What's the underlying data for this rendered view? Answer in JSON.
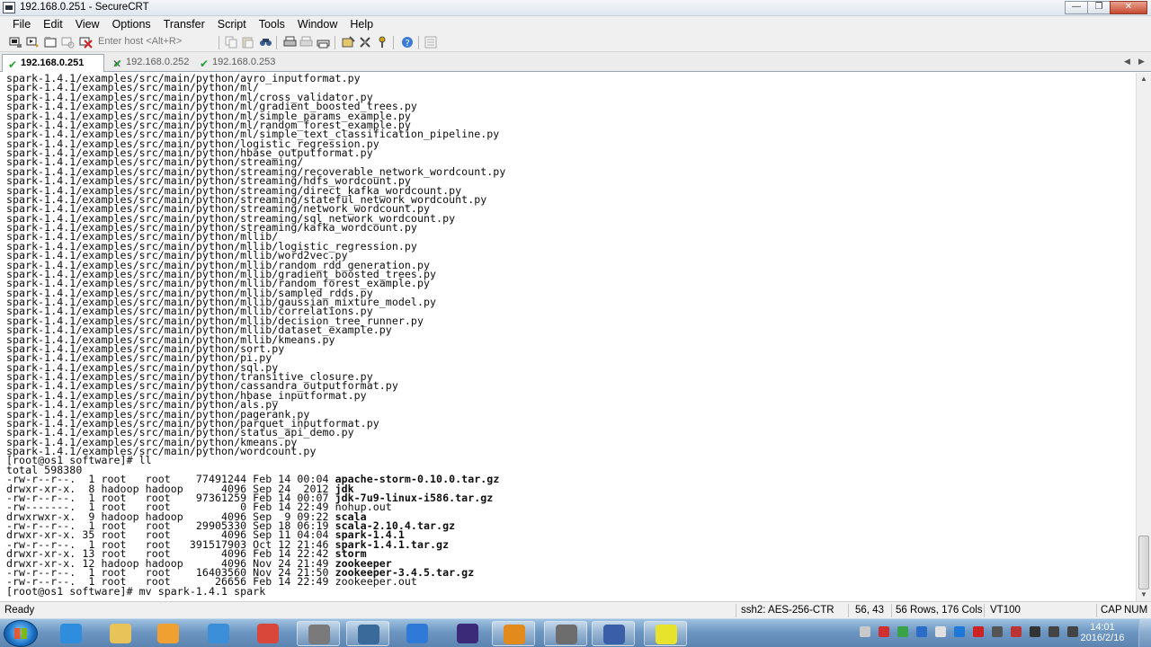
{
  "window": {
    "title": "192.168.0.251 - SecureCRT",
    "buttons": {
      "minimize": "—",
      "maximize": "❐",
      "close": "✕"
    }
  },
  "menu": [
    "File",
    "Edit",
    "View",
    "Options",
    "Transfer",
    "Script",
    "Tools",
    "Window",
    "Help"
  ],
  "toolbar": {
    "host_placeholder": "Enter host <Alt+R>",
    "icons": [
      "connect-icon",
      "quick-connect-icon",
      "connect-tab-icon",
      "reconnect-icon",
      "disconnect-icon",
      "copy-icon",
      "paste-icon",
      "find-icon",
      "print-icon",
      "print-selection-icon",
      "print-setup-icon",
      "session-options-icon",
      "global-options-icon",
      "keymap-icon",
      "help-icon",
      "sftp-icon"
    ]
  },
  "tabs": [
    {
      "label": "192.168.0.251",
      "active": true
    },
    {
      "label": "192.168.0.252",
      "active": false
    },
    {
      "label": "192.168.0.253",
      "active": false
    }
  ],
  "terminal": {
    "lines": [
      {
        "text": "spark-1.4.1/examples/src/main/python/avro_inputformat.py",
        "bold": false
      },
      {
        "text": "spark-1.4.1/examples/src/main/python/ml/",
        "bold": false
      },
      {
        "text": "spark-1.4.1/examples/src/main/python/ml/cross_validator.py",
        "bold": false
      },
      {
        "text": "spark-1.4.1/examples/src/main/python/ml/gradient_boosted_trees.py",
        "bold": false
      },
      {
        "text": "spark-1.4.1/examples/src/main/python/ml/simple_params_example.py",
        "bold": false
      },
      {
        "text": "spark-1.4.1/examples/src/main/python/ml/random_forest_example.py",
        "bold": false
      },
      {
        "text": "spark-1.4.1/examples/src/main/python/ml/simple_text_classification_pipeline.py",
        "bold": false
      },
      {
        "text": "spark-1.4.1/examples/src/main/python/logistic_regression.py",
        "bold": false
      },
      {
        "text": "spark-1.4.1/examples/src/main/python/hbase_outputformat.py",
        "bold": false
      },
      {
        "text": "spark-1.4.1/examples/src/main/python/streaming/",
        "bold": false
      },
      {
        "text": "spark-1.4.1/examples/src/main/python/streaming/recoverable_network_wordcount.py",
        "bold": false
      },
      {
        "text": "spark-1.4.1/examples/src/main/python/streaming/hdfs_wordcount.py",
        "bold": false
      },
      {
        "text": "spark-1.4.1/examples/src/main/python/streaming/direct_kafka_wordcount.py",
        "bold": false
      },
      {
        "text": "spark-1.4.1/examples/src/main/python/streaming/stateful_network_wordcount.py",
        "bold": false
      },
      {
        "text": "spark-1.4.1/examples/src/main/python/streaming/network_wordcount.py",
        "bold": false
      },
      {
        "text": "spark-1.4.1/examples/src/main/python/streaming/sql_network_wordcount.py",
        "bold": false
      },
      {
        "text": "spark-1.4.1/examples/src/main/python/streaming/kafka_wordcount.py",
        "bold": false
      },
      {
        "text": "spark-1.4.1/examples/src/main/python/mllib/",
        "bold": false
      },
      {
        "text": "spark-1.4.1/examples/src/main/python/mllib/logistic_regression.py",
        "bold": false
      },
      {
        "text": "spark-1.4.1/examples/src/main/python/mllib/word2vec.py",
        "bold": false
      },
      {
        "text": "spark-1.4.1/examples/src/main/python/mllib/random_rdd_generation.py",
        "bold": false
      },
      {
        "text": "spark-1.4.1/examples/src/main/python/mllib/gradient_boosted_trees.py",
        "bold": false
      },
      {
        "text": "spark-1.4.1/examples/src/main/python/mllib/random_forest_example.py",
        "bold": false
      },
      {
        "text": "spark-1.4.1/examples/src/main/python/mllib/sampled_rdds.py",
        "bold": false
      },
      {
        "text": "spark-1.4.1/examples/src/main/python/mllib/gaussian_mixture_model.py",
        "bold": false
      },
      {
        "text": "spark-1.4.1/examples/src/main/python/mllib/correlations.py",
        "bold": false
      },
      {
        "text": "spark-1.4.1/examples/src/main/python/mllib/decision_tree_runner.py",
        "bold": false
      },
      {
        "text": "spark-1.4.1/examples/src/main/python/mllib/dataset_example.py",
        "bold": false
      },
      {
        "text": "spark-1.4.1/examples/src/main/python/mllib/kmeans.py",
        "bold": false
      },
      {
        "text": "spark-1.4.1/examples/src/main/python/sort.py",
        "bold": false
      },
      {
        "text": "spark-1.4.1/examples/src/main/python/pi.py",
        "bold": false
      },
      {
        "text": "spark-1.4.1/examples/src/main/python/sql.py",
        "bold": false
      },
      {
        "text": "spark-1.4.1/examples/src/main/python/transitive_closure.py",
        "bold": false
      },
      {
        "text": "spark-1.4.1/examples/src/main/python/cassandra_outputformat.py",
        "bold": false
      },
      {
        "text": "spark-1.4.1/examples/src/main/python/hbase_inputformat.py",
        "bold": false
      },
      {
        "text": "spark-1.4.1/examples/src/main/python/als.py",
        "bold": false
      },
      {
        "text": "spark-1.4.1/examples/src/main/python/pagerank.py",
        "bold": false
      },
      {
        "text": "spark-1.4.1/examples/src/main/python/parquet_inputformat.py",
        "bold": false
      },
      {
        "text": "spark-1.4.1/examples/src/main/python/status_api_demo.py",
        "bold": false
      },
      {
        "text": "spark-1.4.1/examples/src/main/python/kmeans.py",
        "bold": false
      },
      {
        "text": "spark-1.4.1/examples/src/main/python/wordcount.py",
        "bold": false
      },
      {
        "text": "[root@os1 software]# ll",
        "bold": false
      },
      {
        "text": "total 598380",
        "bold": false
      },
      {
        "text": "-rw-r--r--.  1 root   root    77491244 Feb 14 00:04 ",
        "name": "apache-storm-0.10.0.tar.gz",
        "bold": true
      },
      {
        "text": "drwxr-xr-x.  8 hadoop hadoop      4096 Sep 24  2012 ",
        "name": "jdk",
        "bold": true
      },
      {
        "text": "-rw-r--r--.  1 root   root    97361259 Feb 14 00:07 ",
        "name": "jdk-7u9-linux-i586.tar.gz",
        "bold": true
      },
      {
        "text": "-rw-------.  1 root   root           0 Feb 14 22:49 ",
        "name": "nohup.out",
        "bold": false
      },
      {
        "text": "drwxrwxr-x.  9 hadoop hadoop      4096 Sep  9 09:22 ",
        "name": "scala",
        "bold": true
      },
      {
        "text": "-rw-r--r--.  1 root   root    29905330 Sep 18 06:19 ",
        "name": "scala-2.10.4.tar.gz",
        "bold": true
      },
      {
        "text": "drwxr-xr-x. 35 root   root        4096 Sep 11 04:04 ",
        "name": "spark-1.4.1",
        "bold": true
      },
      {
        "text": "-rw-r--r--.  1 root   root   391517903 Oct 12 21:46 ",
        "name": "spark-1.4.1.tar.gz",
        "bold": true
      },
      {
        "text": "drwxr-xr-x. 13 root   root        4096 Feb 14 22:42 ",
        "name": "storm",
        "bold": true
      },
      {
        "text": "drwxr-xr-x. 12 hadoop hadoop      4096 Nov 24 21:49 ",
        "name": "zookeeper",
        "bold": true
      },
      {
        "text": "-rw-r--r--.  1 root   root    16403560 Nov 24 21:50 ",
        "name": "zookeeper-3.4.5.tar.gz",
        "bold": true
      },
      {
        "text": "-rw-r--r--.  1 root   root       26656 Feb 14 22:49 ",
        "name": "zookeeper.out",
        "bold": false
      },
      {
        "text": "[root@os1 software]# mv spark-1.4.1 spark",
        "bold": false
      }
    ]
  },
  "status": {
    "ready": "Ready",
    "cipher": "ssh2: AES-256-CTR",
    "cursor": "56, 43",
    "size": "56 Rows, 176 Cols",
    "emulation": "VT100",
    "caps": "CAP",
    "num": "NUM"
  },
  "taskbar": {
    "apps": [
      {
        "name": "internet-explorer-icon",
        "color": "#2e8ddc",
        "open": false
      },
      {
        "name": "file-explorer-icon",
        "color": "#e8c35a",
        "open": false
      },
      {
        "name": "media-player-icon",
        "color": "#f0a030",
        "open": false
      },
      {
        "name": "sync-app-icon",
        "color": "#3b8fd8",
        "open": false
      },
      {
        "name": "chrome-icon",
        "color": "#d9473b",
        "open": false
      },
      {
        "name": "remote-tool-icon",
        "color": "#7a7a7a",
        "open": true
      },
      {
        "name": "network-tool-icon",
        "color": "#3a6a9a",
        "open": true
      },
      {
        "name": "feather-app-icon",
        "color": "#2f7ad6",
        "open": false
      },
      {
        "name": "eclipse-icon",
        "color": "#3b2a78",
        "open": false
      },
      {
        "name": "virtualbox-icon",
        "color": "#e38a1c",
        "open": true
      },
      {
        "name": "securecrt-icon",
        "color": "#6d6d6d",
        "open": true
      },
      {
        "name": "agent-app-icon",
        "color": "#3b5ea8",
        "open": true
      },
      {
        "name": "m-app-icon",
        "color": "#e7e22c",
        "open": true
      }
    ],
    "tray_icons": [
      "keyboard-icon",
      "flag-icon",
      "shield-icon",
      "windows-icon",
      "network-app-icon",
      "antivirus-icon",
      "qq-icon",
      "update-icon",
      "security-icon",
      "speaker-tray-icon",
      "power-icon",
      "volume-icon"
    ],
    "time": "14:01",
    "date": "2016/2/16"
  }
}
